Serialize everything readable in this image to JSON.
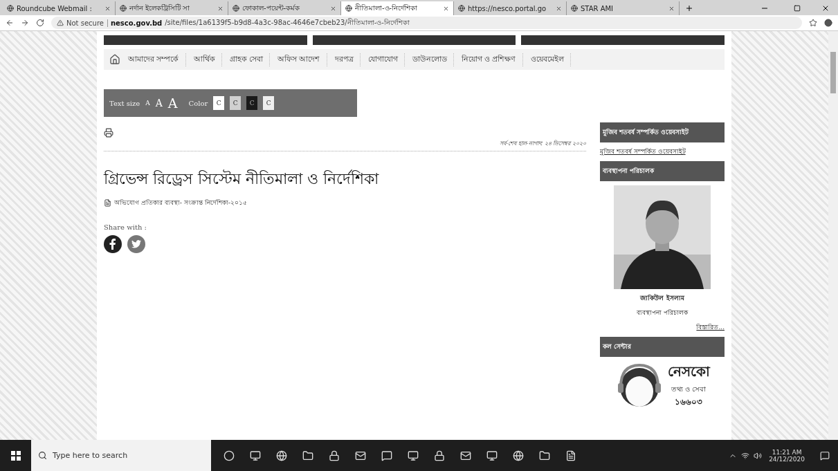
{
  "browser": {
    "tabs": [
      {
        "title": "Roundcube Webmail :",
        "selected": false
      },
      {
        "title": "নর্দান ইলেকট্রিসিটি সা",
        "selected": false
      },
      {
        "title": "ফোকাল-পয়েন্ট-কর্মক",
        "selected": false
      },
      {
        "title": "নীতিমালা-ও-নির্দেশিকা",
        "selected": true
      },
      {
        "title": "https://nesco.portal.go",
        "selected": false
      },
      {
        "title": "STAR AMI",
        "selected": false
      }
    ],
    "security": "Not secure",
    "url_host": "nesco.gov.bd",
    "url_path": "/site/files/1a6139f5-b9d8-4a3c-98ac-4646e7cbeb23/নীতিমালা-ও-নির্দেশিকা"
  },
  "nav": [
    "আমাদের সম্পর্কে",
    "আর্থিক",
    "গ্রাহক সেবা",
    "অফিস আদেশ",
    "দরপত্র",
    "যোগাযোগ",
    "ডাউনলোড",
    "নিয়োগ ও প্রশিক্ষণ",
    "ওয়েবমেইল"
  ],
  "accessibility": {
    "text_size_label": "Text size",
    "sizes": [
      "A",
      "A",
      "A"
    ],
    "color_label": "Color",
    "colors": [
      {
        "label": "C",
        "color": "#ffffff"
      },
      {
        "label": "C",
        "color": "#d0d0d0"
      },
      {
        "label": "C",
        "color": "#1a1a1a"
      },
      {
        "label": "C",
        "color": "#eeeeee"
      }
    ]
  },
  "content": {
    "updated": "সর্ব-শেষ হাল-নাগাদ: ২৪ ডিসেম্বর ২০২০",
    "title": "গ্রিভেন্স রিড্রেস সিস্টেম নীতিমালা ও নির্দেশিকা",
    "file": "অভিযোগ প্রতিকার ব্যবস্থা- সংক্রান্ত নির্দেশিকা-২০১৫",
    "share_label": "Share with :"
  },
  "sidebar": {
    "mujib_header": "মুজিব শতবর্ষ সম্পর্কিত ওয়েবসাইট",
    "mujib_link": "মুজিব শতবর্ষ সম্পর্কিত ওয়েবসাইট",
    "md_header": "ব্যবস্থাপনা পরিচালক",
    "md_name": "জাকিউল ইসলাম",
    "md_role": "ব্যবস্থাপনা পরিচালক",
    "md_more": "বিস্তারিত...",
    "call_header": "কল সেন্টার",
    "call_brand": "নেসকো",
    "call_sub": "তথ্য ও সেবা",
    "call_number": "১৬৬০৩"
  },
  "taskbar": {
    "search_placeholder": "Type here to search",
    "time": "11:21 AM",
    "date": "24/12/2020"
  }
}
